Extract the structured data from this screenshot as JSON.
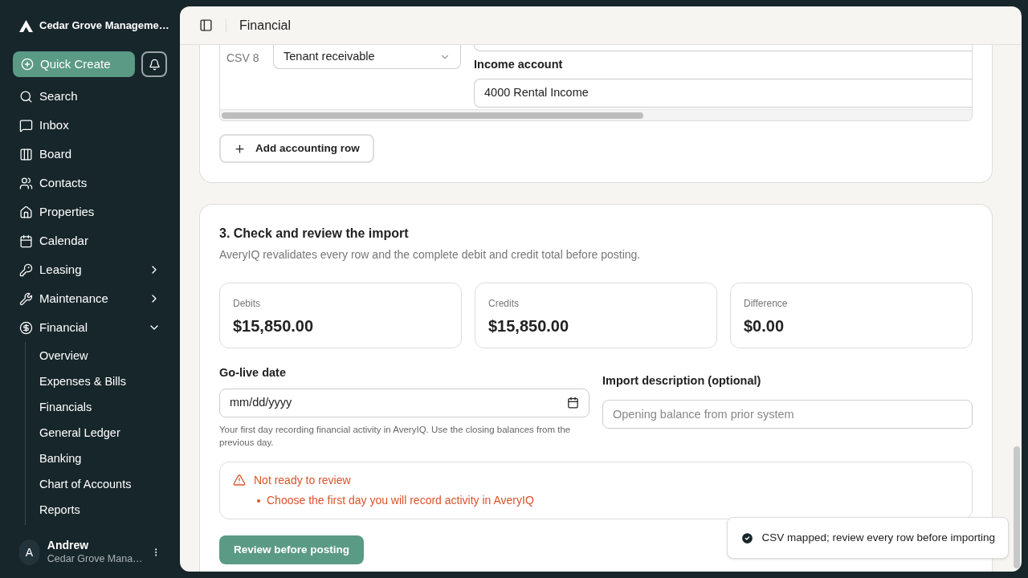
{
  "sidebar": {
    "org": "Cedar Grove Manageme…",
    "quick_create": "Quick Create",
    "items": [
      {
        "label": "Search"
      },
      {
        "label": "Inbox"
      },
      {
        "label": "Board"
      },
      {
        "label": "Contacts"
      },
      {
        "label": "Properties"
      },
      {
        "label": "Calendar"
      },
      {
        "label": "Leasing",
        "expanded": false
      },
      {
        "label": "Maintenance",
        "expanded": false
      },
      {
        "label": "Financial",
        "expanded": true,
        "children": [
          {
            "label": "Overview"
          },
          {
            "label": "Expenses & Bills"
          },
          {
            "label": "Financials"
          },
          {
            "label": "General Ledger"
          },
          {
            "label": "Banking"
          },
          {
            "label": "Chart of Accounts"
          },
          {
            "label": "Reports"
          }
        ]
      }
    ],
    "user": {
      "initial": "A",
      "name": "Andrew",
      "org": "Cedar Grove Mana…"
    }
  },
  "header": {
    "title": "Financial"
  },
  "mapping_row": {
    "row_label": "CSV 8",
    "type": "Tenant receivable",
    "account_label": "Income account",
    "account": "4000 Rental Income"
  },
  "add_row_button": "Add accounting row",
  "review": {
    "title": "3. Check and review the import",
    "subtitle": "AveryIQ revalidates every row and the complete debit and credit total before posting.",
    "totals": [
      {
        "label": "Debits",
        "value": "$15,850.00"
      },
      {
        "label": "Credits",
        "value": "$15,850.00"
      },
      {
        "label": "Difference",
        "value": "$0.00"
      }
    ],
    "date": {
      "label": "Go-live date",
      "placeholder": "mm/dd/yyyy",
      "hint": "Your first day recording financial activity in AveryIQ. Use the closing balances from the previous day."
    },
    "description": {
      "label": "Import description (optional)",
      "placeholder": "Opening balance from prior system"
    },
    "alert": {
      "title": "Not ready to review",
      "items": [
        "Choose the first day you will record activity in AveryIQ"
      ]
    },
    "button": "Review before posting"
  },
  "toast": "CSV mapped; review every row before importing"
}
